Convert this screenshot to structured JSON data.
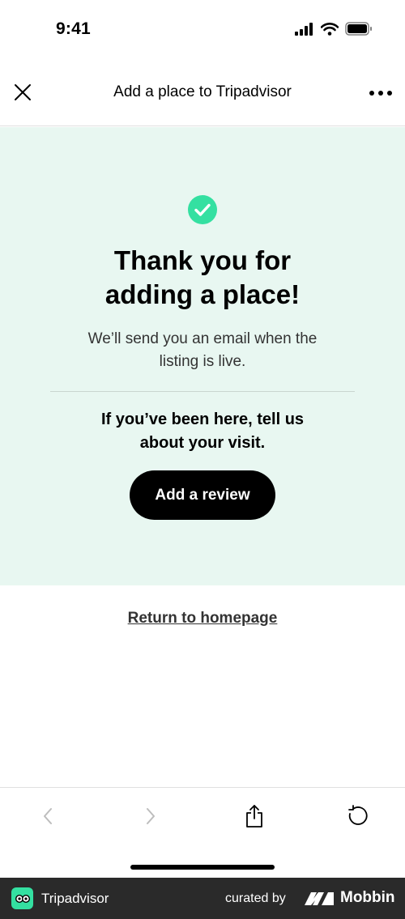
{
  "status_bar": {
    "time": "9:41"
  },
  "header": {
    "title": "Add a place to Tripadvisor"
  },
  "panel": {
    "headline_line1": "Thank you for",
    "headline_line2": "adding a place!",
    "sub_line1": "We’ll send you an email when the",
    "sub_line2": "listing is live.",
    "prompt_line1": "If you’ve been here, tell us",
    "prompt_line2": "about your visit.",
    "review_button": "Add a review"
  },
  "links": {
    "return_home": "Return to homepage"
  },
  "footer": {
    "app_name": "Tripadvisor",
    "curated_by": "curated by",
    "brand": "Mobbin"
  },
  "colors": {
    "panel_bg": "#e8f7f1",
    "accent_green": "#34e0a1",
    "button_bg": "#000000"
  },
  "icons": [
    "close-icon",
    "more-icon",
    "check-circle-icon",
    "back-icon",
    "forward-icon",
    "share-icon",
    "refresh-icon"
  ]
}
